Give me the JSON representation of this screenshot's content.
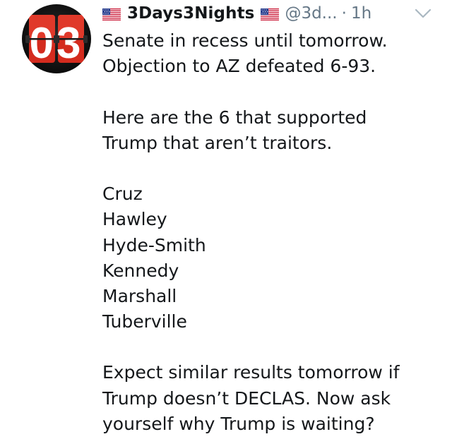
{
  "tweet": {
    "avatar": {
      "text": "03",
      "icon": "flip-clock-avatar-icon",
      "colors": {
        "digit_bg": "#d42b1e",
        "digit_text": "#ffffff",
        "frame": "#1a1a1a"
      }
    },
    "author": {
      "flag_icon": "us-flag-icon",
      "display_name": "3Days3Nights",
      "handle": "@3d...",
      "separator": "·",
      "timestamp": "1h"
    },
    "menu_icon": "chevron-down-icon",
    "paragraphs": [
      [
        "Senate in recess until tomorrow.",
        "Objection to AZ defeated 6-93."
      ],
      [
        "Here are the 6 that supported",
        "Trump that aren’t traitors."
      ],
      [
        "Cruz",
        "Hawley",
        "Hyde-Smith",
        "Kennedy",
        "Marshall",
        "Tuberville"
      ],
      [
        "Expect similar results tomorrow if",
        "Trump doesn’t DECLAS. Now ask",
        "yourself why Trump is waiting?"
      ]
    ]
  },
  "colors": {
    "text": "#14171a",
    "secondary_text": "#657786",
    "background": "#ffffff",
    "chevron": "#aab8c2"
  }
}
